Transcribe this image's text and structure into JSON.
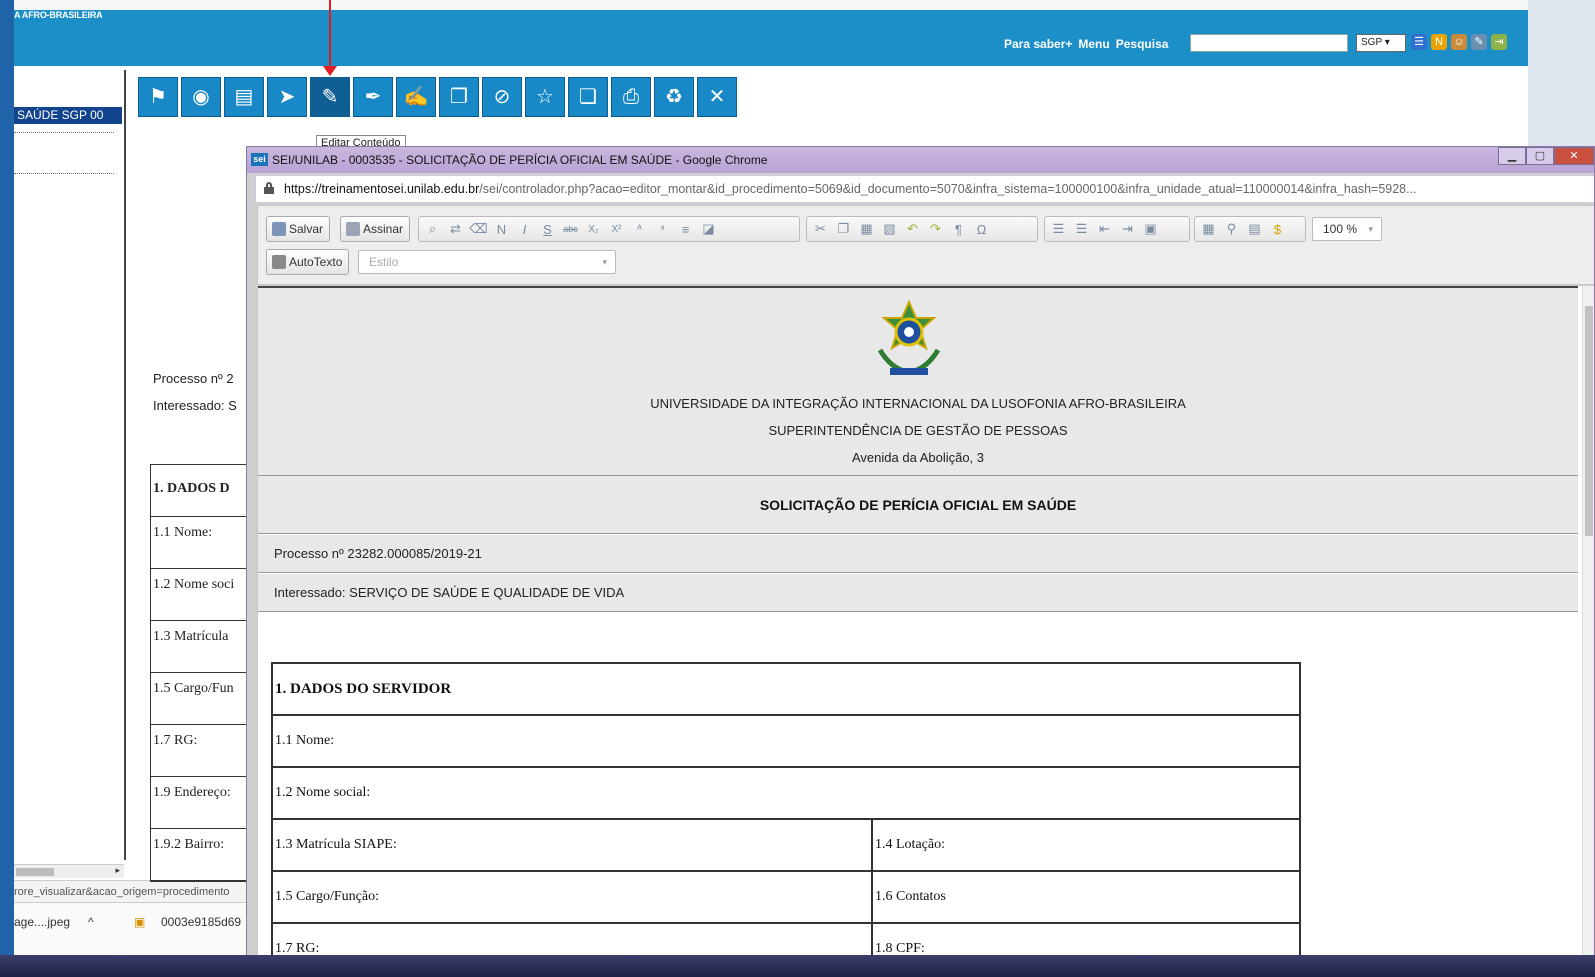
{
  "header": {
    "org_name": "A AFRO-BRASILEIRA",
    "links": [
      "Para saber+",
      "Menu",
      "Pesquisa"
    ],
    "search_value": "",
    "sgp_select": "SGP ▾"
  },
  "left_panel": {
    "unit_tab": "SAÚDE SGP 00",
    "status_url": "rore_visualizar&acao_origem=procedimento",
    "downloads": [
      "age....jpeg",
      "0003e9185d69"
    ]
  },
  "toolbar": {
    "tooltip": "Editar Conteúdo"
  },
  "background_doc": {
    "processo": "Processo nº 2",
    "interessado": "Interessado: S",
    "rows": [
      "1. DADOS D",
      "1.1 Nome:",
      "1.2 Nome soci",
      "1.3 Matrícula",
      "1.5 Cargo/Fun",
      "1.7 RG:",
      "1.9 Endereço:",
      "1.9.2 Bairro:"
    ]
  },
  "popup": {
    "favicon": "sei",
    "title": "SEI/UNILAB - 0003535 - SOLICITAÇÃO DE PERÍCIA OFICIAL EM SAÚDE - Google Chrome",
    "url_host": "https://treinamentosei.unilab.edu.br",
    "url_path": "/sei/controlador.php?acao=editor_montar&id_procedimento=5069&id_documento=5070&infra_sistema=100000100&infra_unidade_atual=110000014&infra_hash=5928...",
    "editor": {
      "salvar": "Salvar",
      "assinar": "Assinar",
      "autotexto": "AutoTexto",
      "estilo_placeholder": "Estilo",
      "zoom": "100 %",
      "format_glyphs": [
        "N",
        "I",
        "S",
        "abc",
        "X₂",
        "X²"
      ],
      "insert_glyphs": [
        "¶",
        "Ω"
      ]
    },
    "document": {
      "institution": "UNIVERSIDADE DA INTEGRAÇÃO INTERNACIONAL DA LUSOFONIA AFRO-BRASILEIRA",
      "department": "SUPERINTENDÊNCIA DE GESTÃO DE PESSOAS",
      "address": "Avenida da Abolição, 3",
      "title": "SOLICITAÇÃO DE PERÍCIA OFICIAL EM SAÚDE",
      "processo": "Processo nº 23282.000085/2019-21",
      "interessado": "Interessado: SERVIÇO DE SAÚDE E QUALIDADE DE VIDA",
      "table": {
        "section": "1.  DADOS DO SERVIDOR",
        "nome": "1.1 Nome:",
        "nome_social": "1.2 Nome social:",
        "matricula": "1.3 Matrícula SIAPE:",
        "lotacao": "1.4 Lotação:",
        "cargo": "1.5 Cargo/Função:",
        "contatos": "1.6 Contatos",
        "rg": "1.7 RG:",
        "cpf": "1.8 CPF:"
      }
    }
  },
  "colors": {
    "header_blue": "#1c8fc9",
    "unit_tab": "#12448e",
    "toolbar_icon_bg": "#1888c6",
    "arrow_red": "#e31b23",
    "chrome_title": "#c9b7df"
  },
  "icons": [
    "user-group-icon",
    "eye-icon",
    "document-icon",
    "send-icon",
    "edit-content-icon",
    "pen-icon",
    "sign-icon",
    "copy-docs-icon",
    "cancel-icon",
    "new-doc-icon",
    "duplicate-icon",
    "print-icon",
    "recycle-icon",
    "exclude-icon"
  ]
}
